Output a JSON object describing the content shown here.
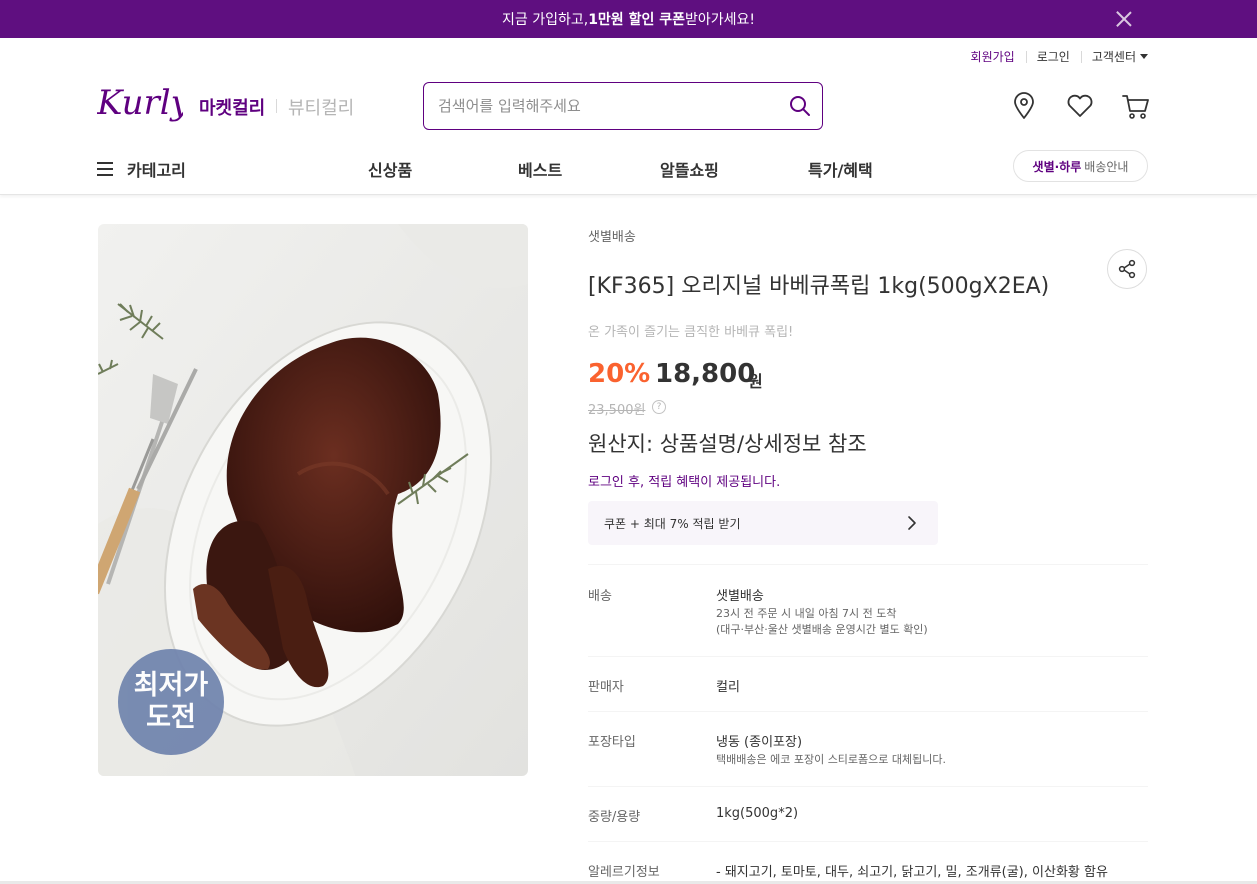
{
  "promo": {
    "text_before": "지금 가입하고, ",
    "text_bold": "1만원 할인 쿠폰",
    "text_after": " 받아가세요!"
  },
  "util": {
    "join": "회원가입",
    "login": "로그인",
    "cs": "고객센터"
  },
  "header": {
    "logo_text": "Kurly",
    "tab_market": "마켓컬리",
    "tab_beauty": "뷰티컬리",
    "search_placeholder": "검색어를 입력해주세요"
  },
  "gnb": {
    "category": "카테고리",
    "items": [
      "신상품",
      "베스트",
      "알뜰쇼핑",
      "특가/혜택"
    ],
    "delivery_highlight": "샛별·하루",
    "delivery_rest": "배송안내"
  },
  "product": {
    "badge_line1": "최저가",
    "badge_line2": "도전",
    "tag": "샛별배송",
    "title": "[KF365] 오리지널 바베큐폭립 1kg(500gX2EA)",
    "subtitle": "온 가족이 즐기는 큼직한 바베큐 폭립!",
    "discount": "20%",
    "price": "18,800",
    "currency": "원",
    "original_price": "23,500원",
    "origin": "원산지: 상품설명/상세정보 참조",
    "login_note": "로그인 후, 적립 혜택이 제공됩니다.",
    "coupon": "쿠폰 + 최대 7% 적립 받기"
  },
  "details": {
    "delivery_label": "배송",
    "delivery_value": "샛별배송",
    "delivery_note1": "23시 전 주문 시 내일 아침 7시 전 도착",
    "delivery_note2": "(대구·부산·울산 샛별배송 운영시간 별도 확인)",
    "seller_label": "판매자",
    "seller_value": "컬리",
    "pack_label": "포장타입",
    "pack_value": "냉동 (종이포장)",
    "pack_note": "택배배송은 에코 포장이 스티로폼으로 대체됩니다.",
    "weight_label": "중량/용량",
    "weight_value": "1kg(500g*2)",
    "allergy_label": "알레르기정보",
    "allergy_value": "- 돼지고기, 토마토, 대두, 쇠고기, 닭고기, 밀, 조개류(굴), 이산화황 함유"
  },
  "colors": {
    "brand": "#5f0080",
    "promo_bg": "#5f0f80",
    "discount": "#fa622f"
  }
}
